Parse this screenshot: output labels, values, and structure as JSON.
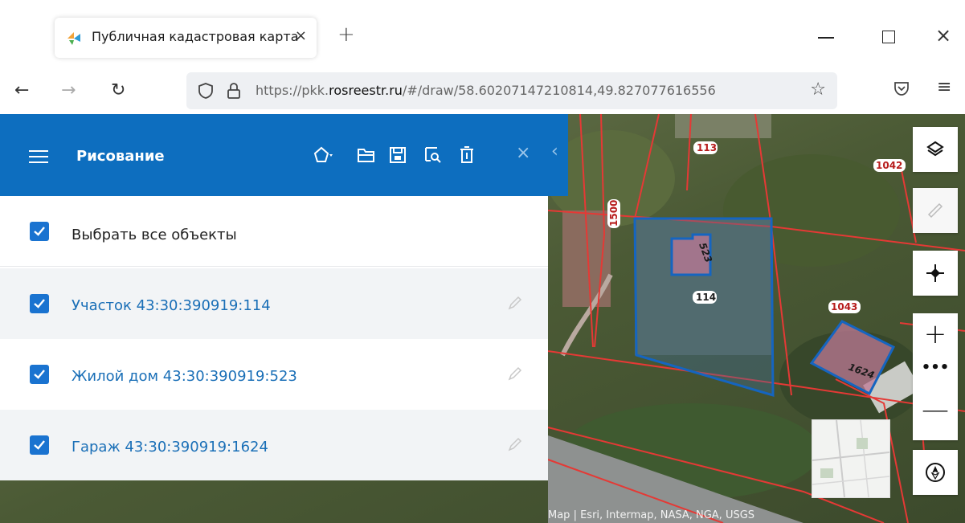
{
  "browser": {
    "tab_title": "Публичная кадастровая карта",
    "tab_close": "×",
    "new_tab": "+",
    "url_prefix": "https://pkk.",
    "url_host": "rosreestr.ru",
    "url_path": "/#/draw/58.60207147210814,49.827077616556",
    "win_close": "×"
  },
  "panel": {
    "title": "Рисование",
    "select_all_label": "Выбрать все объекты",
    "items": [
      {
        "label": "Участок 43:30:390919:114",
        "checked": true
      },
      {
        "label": "Жилой дом 43:30:390919:523",
        "checked": true
      },
      {
        "label": "Гараж 43:30:390919:1624",
        "checked": true
      }
    ],
    "close": "×",
    "collapse": "‹"
  },
  "map": {
    "attribution": "Map | Esri, Intermap, NASA, NGA, USGS",
    "labels": {
      "l113": "113",
      "l1042": "1042",
      "l1500": "1500",
      "l523": "523",
      "l114": "114",
      "l1043": "1043",
      "l1624": "1624"
    },
    "zoom_in": "+",
    "zoom_more": "•••",
    "zoom_out": "—"
  },
  "colors": {
    "header": "#0d6ebf",
    "link": "#1a6fb7",
    "checkbox": "#1a73d0",
    "parcel_outline": "#1565c0",
    "cadastre_line": "#e53935"
  }
}
